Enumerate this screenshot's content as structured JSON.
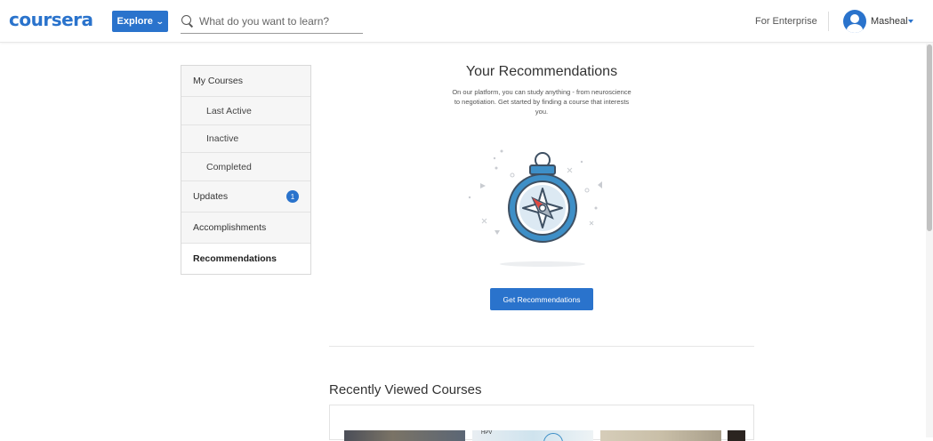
{
  "header": {
    "logo": "coursera",
    "explore_label": "Explore",
    "search_placeholder": "What do you want to learn?",
    "enterprise_label": "For Enterprise",
    "username": "Masheal"
  },
  "sidebar": {
    "items": [
      {
        "label": "My Courses"
      },
      {
        "label": "Last Active"
      },
      {
        "label": "Inactive"
      },
      {
        "label": "Completed"
      },
      {
        "label": "Updates",
        "badge": "1"
      },
      {
        "label": "Accomplishments"
      },
      {
        "label": "Recommendations"
      }
    ]
  },
  "main": {
    "title": "Your Recommendations",
    "description": "On our platform, you can study anything - from neuroscience to negotiation. Get started by finding a course that interests you.",
    "cta_label": "Get Recommendations",
    "recent_title": "Recently Viewed Courses",
    "recent_thumbs": [
      {
        "caption": ""
      },
      {
        "caption": "HPV"
      },
      {
        "caption": ""
      },
      {
        "caption": ""
      }
    ]
  },
  "colors": {
    "brand": "#2a73cc",
    "illustration_blue": "#3e8fc7",
    "illustration_red": "#e0473f"
  },
  "icons": [
    "search-icon",
    "chevron-down-icon",
    "avatar-icon",
    "caret-down-icon",
    "compass-icon"
  ]
}
